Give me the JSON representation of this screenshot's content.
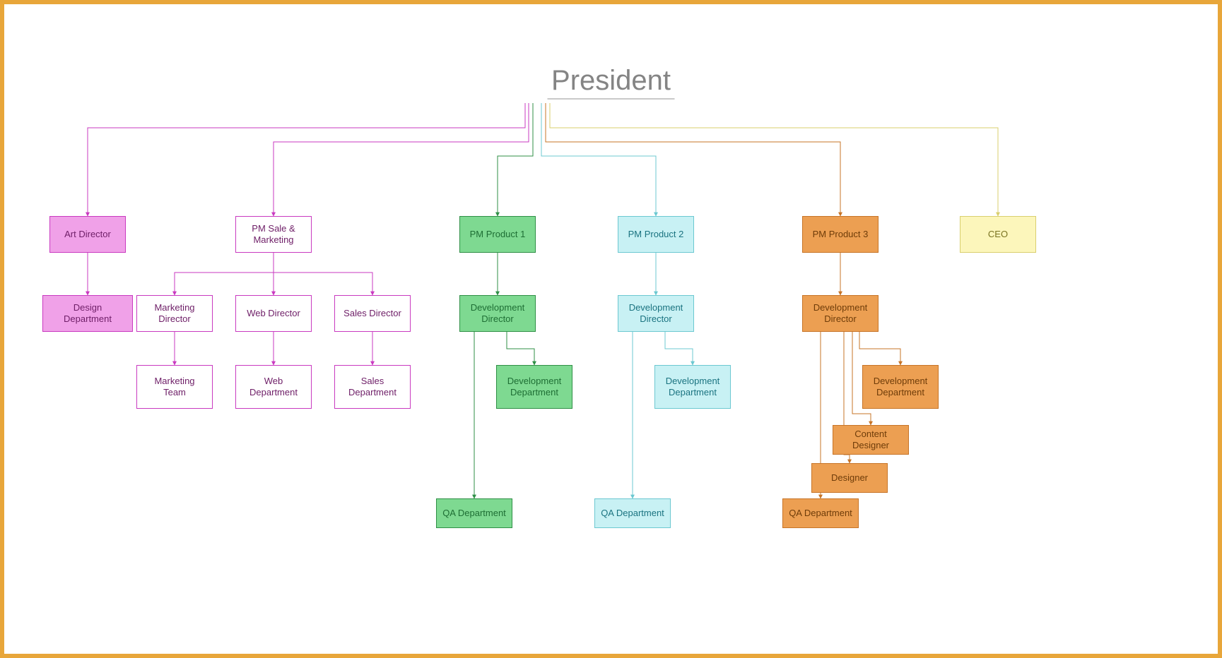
{
  "title": "President",
  "nodes": {
    "art_director": "Art Director",
    "design_dept": "Design Department",
    "pm_sale_mkt": "PM Sale & Marketing",
    "mkt_director": "Marketing Director",
    "web_director": "Web Director",
    "sales_director": "Sales Director",
    "mkt_team": "Marketing Team",
    "web_dept": "Web Department",
    "sales_dept": "Sales Department",
    "pm_prod1": "PM Product 1",
    "dev_dir1": "Development Director",
    "dev_dept1": "Development Department",
    "qa_dept1": "QA Department",
    "pm_prod2": "PM Product 2",
    "dev_dir2": "Development Director",
    "dev_dept2": "Development Department",
    "qa_dept2": "QA Department",
    "pm_prod3": "PM Product 3",
    "dev_dir3": "Development Director",
    "dev_dept3": "Development Department",
    "content_des": "Content Designer",
    "designer": "Designer",
    "qa_dept3": "QA Department",
    "ceo": "CEO"
  },
  "colors": {
    "pink_bg": "#f0a1e8",
    "pink_border": "#c93ac0",
    "magenta_border": "#c93ac0",
    "green_bg": "#7ed991",
    "green_border": "#2f8f46",
    "green_text": "#1e6e34",
    "cyan_bg": "#c8f1f4",
    "cyan_border": "#6cc8d1",
    "cyan_text": "#1a7380",
    "orange_bg": "#ec9f52",
    "orange_border": "#c77427",
    "orange_text": "#6e3c09",
    "yellow_bg": "#fcf6bb",
    "yellow_border": "#d9cf6e",
    "white": "#ffffff",
    "grey_text": "#6b6b6b"
  },
  "chart_data": {
    "type": "org-chart",
    "root": "President",
    "children": [
      {
        "name": "Art Director",
        "color": "pink",
        "children": [
          {
            "name": "Design Department",
            "color": "pink"
          }
        ]
      },
      {
        "name": "PM Sale & Marketing",
        "color": "magenta-outline",
        "children": [
          {
            "name": "Marketing Director",
            "children": [
              {
                "name": "Marketing Team"
              }
            ]
          },
          {
            "name": "Web Director",
            "children": [
              {
                "name": "Web Department"
              }
            ]
          },
          {
            "name": "Sales Director",
            "children": [
              {
                "name": "Sales Department"
              }
            ]
          }
        ]
      },
      {
        "name": "PM Product 1",
        "color": "green",
        "children": [
          {
            "name": "Development Director",
            "children": [
              {
                "name": "Development Department"
              },
              {
                "name": "QA Department"
              }
            ]
          }
        ]
      },
      {
        "name": "PM Product 2",
        "color": "cyan",
        "children": [
          {
            "name": "Development Director",
            "children": [
              {
                "name": "Development Department"
              },
              {
                "name": "QA Department"
              }
            ]
          }
        ]
      },
      {
        "name": "PM Product 3",
        "color": "orange",
        "children": [
          {
            "name": "Development Director",
            "children": [
              {
                "name": "Development Department"
              },
              {
                "name": "Content Designer"
              },
              {
                "name": "Designer"
              },
              {
                "name": "QA Department"
              }
            ]
          }
        ]
      },
      {
        "name": "CEO",
        "color": "yellow"
      }
    ]
  }
}
